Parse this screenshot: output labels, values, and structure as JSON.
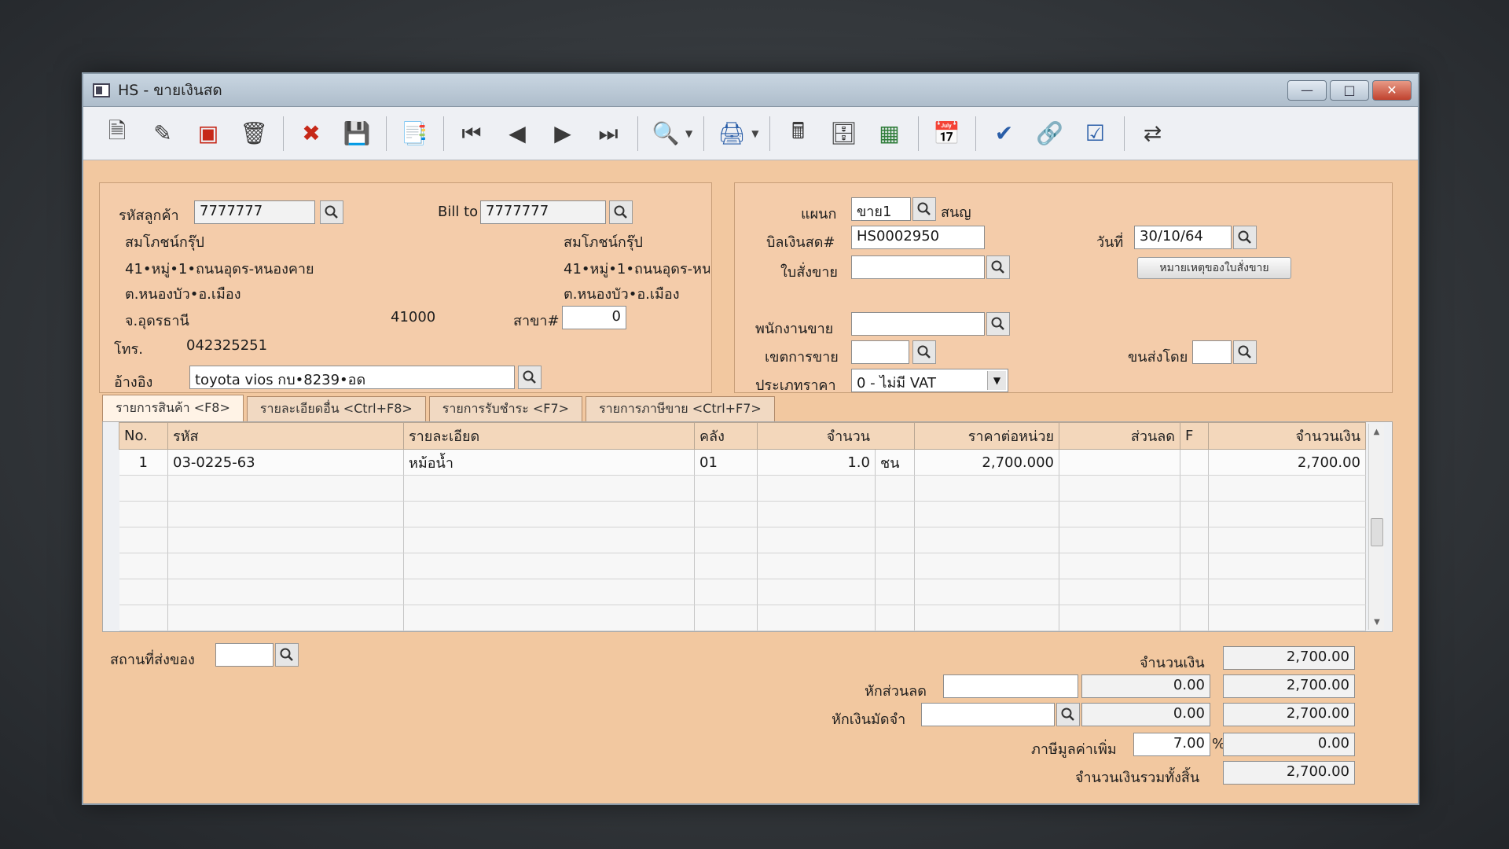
{
  "window": {
    "title": "HS - ขายเงินสด"
  },
  "customer": {
    "code_label": "รหัสลูกค้า",
    "code": "7777777",
    "name": "สมโภชน์กรุ๊ป",
    "address1": "41•หมู่•1•ถนนอุดร-หนองคาย",
    "address2": "ต.หนองบัว•อ.เมือง",
    "province": "จ.อุดรธานี",
    "postcode": "41000",
    "phone_label": "โทร.",
    "phone": "042325251",
    "ref_label": "อ้างอิง",
    "ref": "toyota vios กบ•8239•อด"
  },
  "billto": {
    "label": "Bill to",
    "code": "7777777",
    "name": "สมโภชน์กรุ๊ป",
    "address1": "41•หมู่•1•ถนนอุดร-หน",
    "address2": "ต.หนองบัว•อ.เมือง",
    "branch_label": "สาขา#",
    "branch": "0"
  },
  "doc": {
    "dept_label": "แผนก",
    "dept": "ขาย1",
    "dept_name": "สนญ",
    "bill_label": "บิลเงินสด#",
    "bill": "HS0002950",
    "date_label": "วันที่",
    "date": "30/10/64",
    "so_label": "ใบสั่งขาย",
    "so": "",
    "so_note_button": "หมายเหตุของใบสั่งขาย",
    "salesman_label": "พนักงานขาย",
    "salesman": "",
    "area_label": "เขตการขาย",
    "area": "",
    "ship_label": "ขนส่งโดย",
    "ship": "",
    "price_type_label": "ประเภทราคา",
    "price_type": "0 - ไม่มี VAT"
  },
  "tabs": [
    "รายการสินค้า <F8>",
    "รายละเอียดอื่น <Ctrl+F8>",
    "รายการรับชำระ <F7>",
    "รายการภาษีขาย <Ctrl+F7>"
  ],
  "grid": {
    "headers": [
      "No.",
      "รหัส",
      "รายละเอียด",
      "คลัง",
      "จำนวน",
      "ราคาต่อหน่วย",
      "ส่วนลด",
      "F",
      "จำนวนเงิน"
    ],
    "rows": [
      {
        "no": "1",
        "code": "03-0225-63",
        "desc": "หม้อน้ำ",
        "wh": "01",
        "qty": "1.0",
        "unit": "ชน",
        "price": "2,700.000",
        "discount": "",
        "f": "",
        "amount": "2,700.00"
      }
    ]
  },
  "footer": {
    "ship_place_label": "สถานที่ส่งของ",
    "ship_place": "",
    "amount_label": "จำนวนเงิน",
    "amount": "2,700.00",
    "discount_label": "หักส่วนลด",
    "discount_input": "",
    "discount_value": "0.00",
    "after_discount": "2,700.00",
    "deposit_label": "หักเงินมัดจำ",
    "deposit_input": "",
    "deposit_value": "0.00",
    "after_deposit": "2,700.00",
    "vat_label": "ภาษีมูลค่าเพิ่ม",
    "vat_rate": "7.00",
    "vat_pct": "%",
    "vat_amount": "0.00",
    "total_label": "จำนวนเงินรวมทั้งสิ้น",
    "total": "2,700.00"
  },
  "icons": [
    "new-doc-icon",
    "edit-icon",
    "void-icon",
    "delete-icon",
    "cancel-icon",
    "save-icon",
    "copy-icon",
    "first-icon",
    "prev-icon",
    "next-icon",
    "last-icon",
    "find-icon",
    "print-icon",
    "calc-icon",
    "report-icon",
    "approve-icon",
    "post-icon",
    "link-icon",
    "ok-icon",
    "transfer-icon"
  ]
}
